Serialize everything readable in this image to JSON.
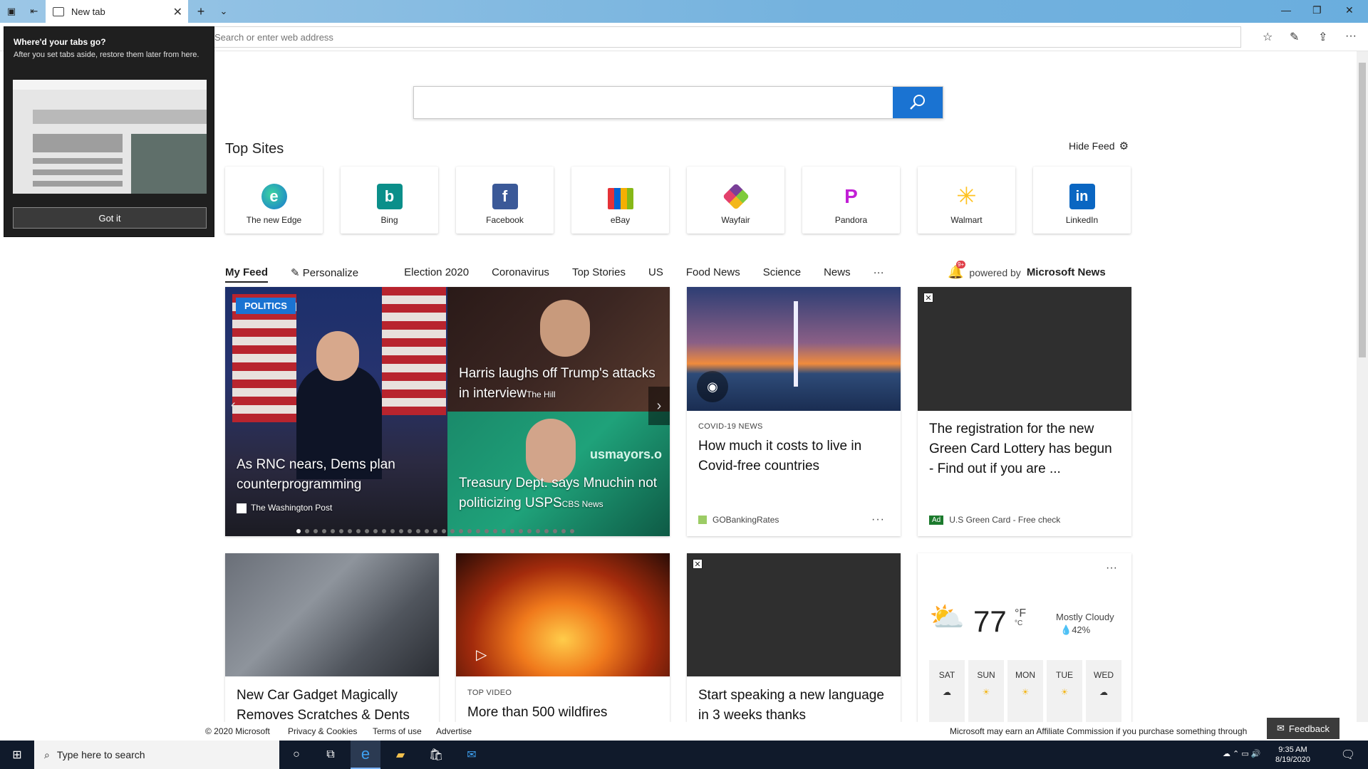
{
  "browser": {
    "tab_title": "New tab",
    "address_placeholder": "Search or enter web address"
  },
  "popup": {
    "title": "Where'd your tabs go?",
    "text": "After you set tabs aside, restore them later from here.",
    "button": "Got it"
  },
  "top_sites": {
    "title": "Top Sites",
    "hide_feed": "Hide Feed",
    "sites": [
      {
        "label": "The new Edge",
        "color": "#1f8fd6",
        "glyph": "e"
      },
      {
        "label": "Bing",
        "color": "#0b8f8a",
        "glyph": "b"
      },
      {
        "label": "Facebook",
        "color": "#3b5998",
        "glyph": "f"
      },
      {
        "label": "eBay",
        "color": "#1a1a1a",
        "glyph": "🛍"
      },
      {
        "label": "Wayfair",
        "color": "#7a3f98",
        "glyph": "◆"
      },
      {
        "label": "Pandora",
        "color": "#ffffff",
        "glyph": "P"
      },
      {
        "label": "Walmart",
        "color": "#ffffff",
        "glyph": "✳"
      },
      {
        "label": "LinkedIn",
        "color": "#0a66c2",
        "glyph": "in"
      }
    ]
  },
  "feed_nav": {
    "items": [
      "My Feed",
      "Personalize",
      "Election 2020",
      "Coronavirus",
      "Top Stories",
      "US",
      "Food News",
      "Science",
      "News",
      "···"
    ],
    "notification_count": "9+",
    "powered_by_prefix": "powered by",
    "powered_by_brand": "Microsoft News"
  },
  "carousel": {
    "badge": "POLITICS",
    "left_caption": "As RNC nears, Dems plan counterprogramming",
    "left_source": "The Washington Post",
    "top_right_caption": "Harris laughs off Trump's attacks in interview",
    "top_right_source": "The Hill",
    "bottom_right_caption": "Treasury Dept. says Mnuchin not politicizing USPS",
    "bottom_right_source": "CBS News",
    "overlay_text": "usmayors.o"
  },
  "cards": {
    "covid": {
      "kicker": "COVID-19 NEWS",
      "headline": "How much it costs to live in Covid-free countries",
      "provider": "GOBankingRates",
      "more": "···"
    },
    "greencard": {
      "headline": "The registration for the new Green Card Lottery has begun - Find out if you are ...",
      "ad": "Ad",
      "provider": "U.S Green Card - Free check"
    },
    "gadget": {
      "headline": "New Car Gadget Magically Removes Scratches & Dents"
    },
    "wildfire": {
      "kicker": "TOP VIDEO",
      "headline": "More than 500 wildfires"
    },
    "language": {
      "headline": "Start speaking a new language in 3 weeks thanks"
    }
  },
  "weather": {
    "temp": "77",
    "unit_f": "°F",
    "unit_c": "°C",
    "condition": "Mostly Cloudy",
    "humidity": "42%",
    "more": "···",
    "days": [
      "SAT",
      "SUN",
      "MON",
      "TUE",
      "WED"
    ]
  },
  "footer": {
    "copyright": "© 2020 Microsoft",
    "privacy": "Privacy & Cookies",
    "terms": "Terms of use",
    "advertise": "Advertise",
    "affiliate": "Microsoft may earn an Affiliate Commission if you purchase something through",
    "feedback": "Feedback"
  },
  "taskbar": {
    "search_placeholder": "Type here to search",
    "time": "9:35 AM",
    "date": "8/19/2020"
  },
  "colors": {
    "accent": "#1a73d2",
    "taskbar": "#101a2b"
  }
}
